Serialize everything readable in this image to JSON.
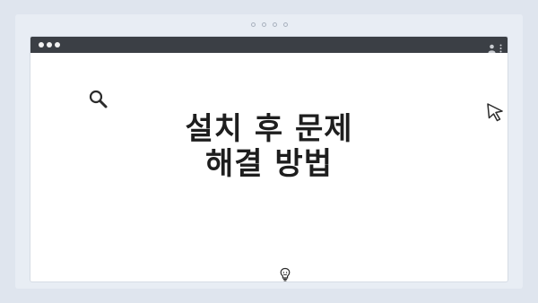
{
  "heading": {
    "line1": "설치 후 문제",
    "line2": "해결 방법"
  },
  "icons": {
    "search": "search-icon",
    "cursor": "cursor-icon",
    "bulb": "lightbulb-icon",
    "user": "user-icon",
    "more": "more-vertical-icon"
  },
  "colors": {
    "background": "#dfe5ee",
    "titlebar": "#3b3f45",
    "text": "#1e1e1e"
  }
}
